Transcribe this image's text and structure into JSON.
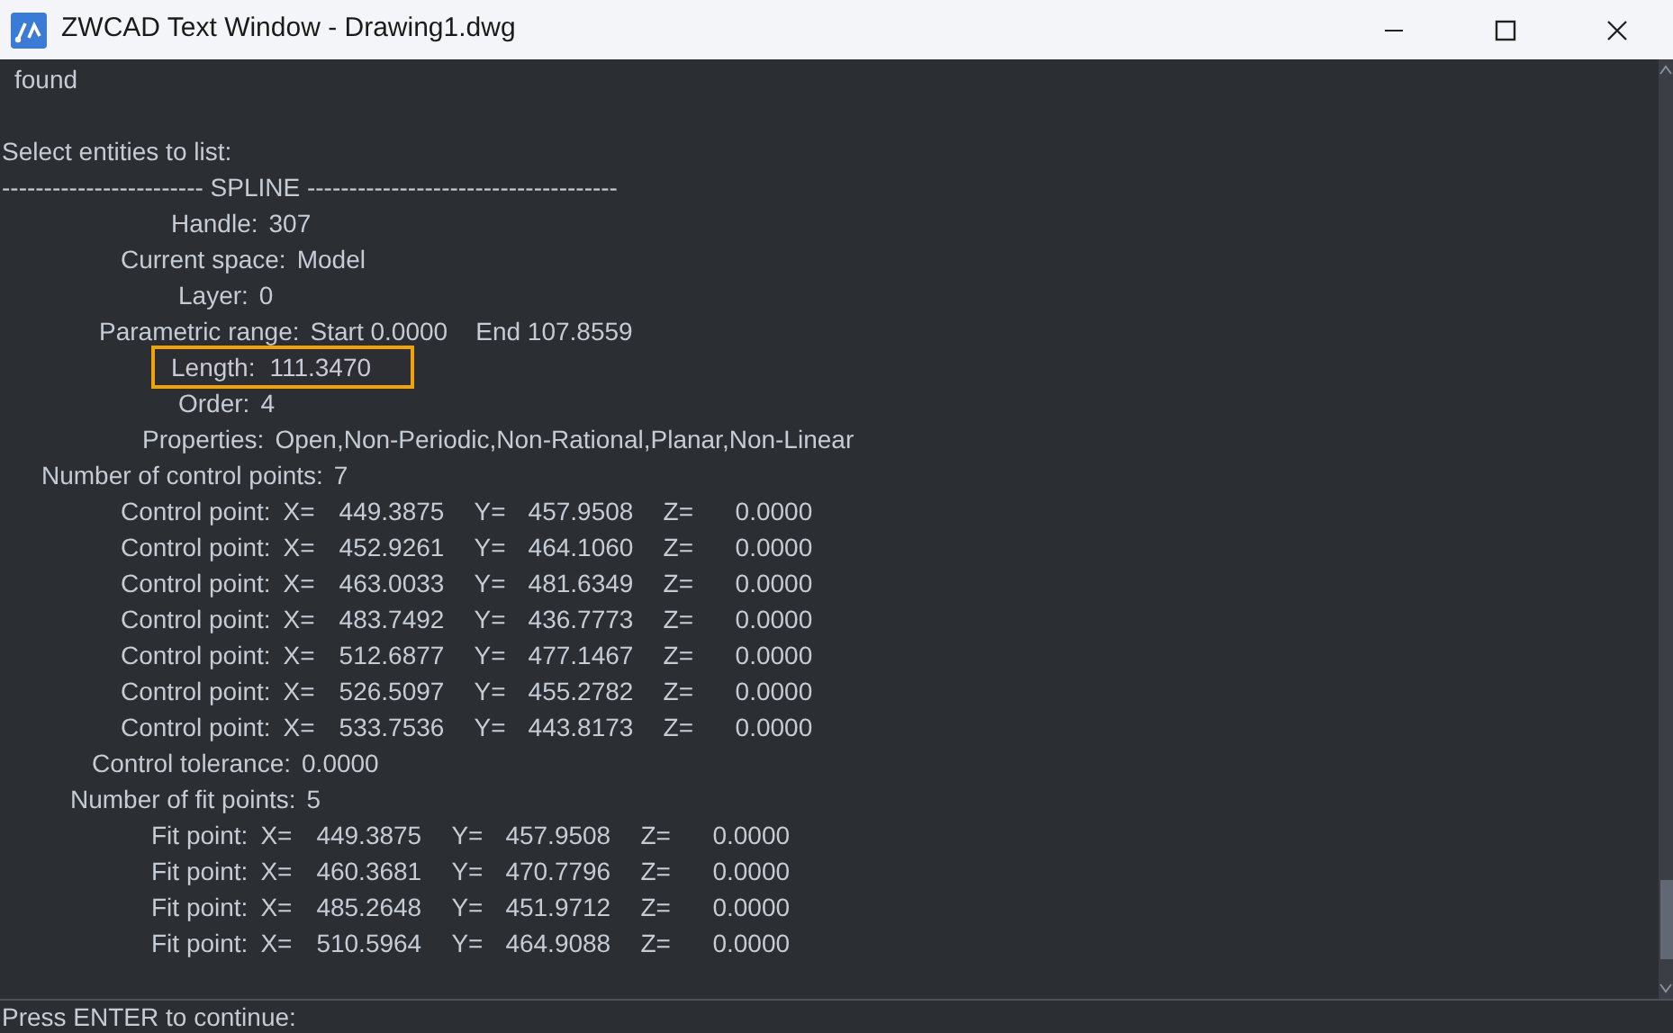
{
  "window": {
    "title": "ZWCAD Text Window - Drawing1.dwg"
  },
  "lines": [
    {
      "kind": "status",
      "text": "found"
    },
    {
      "kind": "prompt",
      "text": "Select entities to list:"
    },
    {
      "kind": "rule",
      "text": "------------------------ SPLINE -------------------------------------"
    },
    {
      "kind": "property",
      "label": "Handle:",
      "value": "307",
      "highlighted": false
    },
    {
      "kind": "property",
      "label": "Current space:",
      "value": "Model",
      "highlighted": false
    },
    {
      "kind": "property",
      "label": "Layer:",
      "value": "0",
      "highlighted": false
    },
    {
      "kind": "property",
      "label": "Parametric range:",
      "value": "Start 0.0000    End 107.8559",
      "highlighted": false
    },
    {
      "kind": "property",
      "label": "Length:",
      "value": "111.3470",
      "highlighted": true
    },
    {
      "kind": "property",
      "label": "Order:",
      "value": "4",
      "highlighted": false
    },
    {
      "kind": "property",
      "label": "Properties:",
      "value": "Open,Non-Periodic,Non-Rational,Planar,Non-Linear",
      "highlighted": false
    },
    {
      "kind": "property",
      "label": "Number of control points:",
      "value": "7",
      "highlighted": false
    },
    {
      "kind": "point",
      "cells": [
        "Control point:",
        "X=",
        "449.3875",
        "Y=",
        "457.9508",
        "Z=",
        "0.0000"
      ]
    },
    {
      "kind": "point",
      "cells": [
        "Control point:",
        "X=",
        "452.9261",
        "Y=",
        "464.1060",
        "Z=",
        "0.0000"
      ]
    },
    {
      "kind": "point",
      "cells": [
        "Control point:",
        "X=",
        "463.0033",
        "Y=",
        "481.6349",
        "Z=",
        "0.0000"
      ]
    },
    {
      "kind": "point",
      "cells": [
        "Control point:",
        "X=",
        "483.7492",
        "Y=",
        "436.7773",
        "Z=",
        "0.0000"
      ]
    },
    {
      "kind": "point",
      "cells": [
        "Control point:",
        "X=",
        "512.6877",
        "Y=",
        "477.1467",
        "Z=",
        "0.0000"
      ]
    },
    {
      "kind": "point",
      "cells": [
        "Control point:",
        "X=",
        "526.5097",
        "Y=",
        "455.2782",
        "Z=",
        "0.0000"
      ]
    },
    {
      "kind": "point",
      "cells": [
        "Control point:",
        "X=",
        "533.7536",
        "Y=",
        "443.8173",
        "Z=",
        "0.0000"
      ]
    },
    {
      "kind": "property",
      "label": "Control tolerance:",
      "value": "0.0000",
      "highlighted": false
    },
    {
      "kind": "property",
      "label": "Number of fit points:",
      "value": "5",
      "highlighted": false
    },
    {
      "kind": "point",
      "cells": [
        "Fit point:",
        "X=",
        "449.3875",
        "Y=",
        "457.9508",
        "Z=",
        "0.0000"
      ]
    },
    {
      "kind": "point",
      "cells": [
        "Fit point:",
        "X=",
        "460.3681",
        "Y=",
        "470.7796",
        "Z=",
        "0.0000"
      ]
    },
    {
      "kind": "point",
      "cells": [
        "Fit point:",
        "X=",
        "485.2648",
        "Y=",
        "451.9712",
        "Z=",
        "0.0000"
      ]
    },
    {
      "kind": "point",
      "cells": [
        "Fit point:",
        "X=",
        "510.5964",
        "Y=",
        "464.9088",
        "Z=",
        "0.0000"
      ]
    }
  ],
  "command_prompt": "Press ENTER to continue:"
}
